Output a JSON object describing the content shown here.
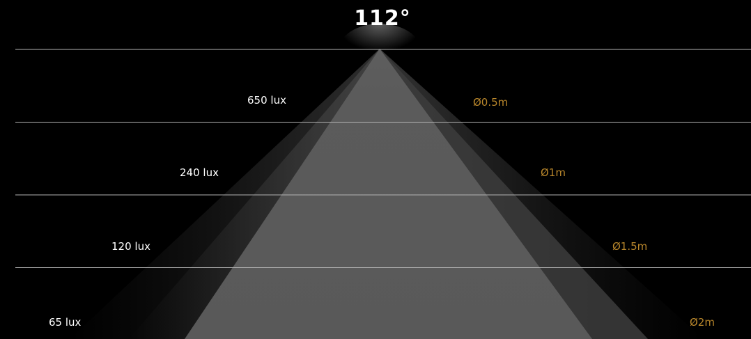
{
  "beam_angle": "112°",
  "colors": {
    "background": "#000000",
    "line": "#b3b3b3",
    "lux_text": "#ffffff",
    "diameter_text": "#b8862b",
    "beam_core": "#5a5a5a"
  },
  "levels": [
    {
      "lux": "650 lux",
      "diameter": "Ø0.5m"
    },
    {
      "lux": "240 lux",
      "diameter": "Ø1m"
    },
    {
      "lux": "120 lux",
      "diameter": "Ø1.5m"
    },
    {
      "lux": "65 lux",
      "diameter": "Ø2m"
    }
  ]
}
